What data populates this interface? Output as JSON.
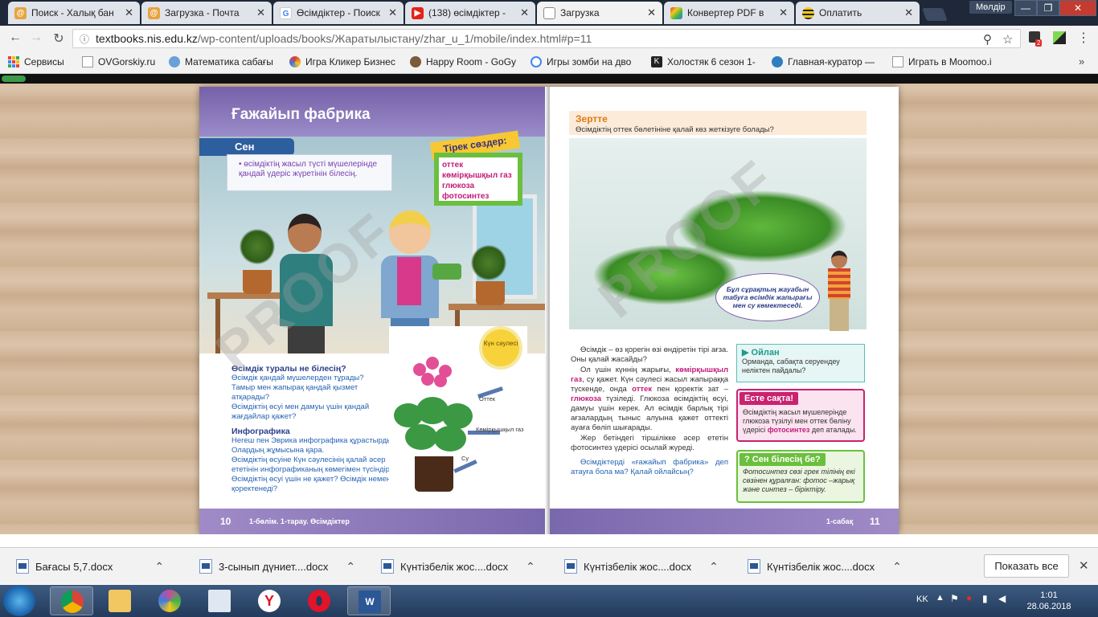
{
  "browser": {
    "tabs": [
      {
        "label": "Поиск - Халық бан",
        "icon": "mail-at-icon",
        "color": "#e8a33d"
      },
      {
        "label": "Загрузка - Почта",
        "icon": "mail-at-icon",
        "color": "#e8a33d"
      },
      {
        "label": "Өсімдіктер - Поиск",
        "icon": "google-icon",
        "color": "#4285f4"
      },
      {
        "label": "(138) өсімдіктер -",
        "icon": "youtube-icon",
        "color": "#e62117"
      },
      {
        "label": "Загрузка",
        "icon": "page-icon",
        "color": "#888888",
        "active": true
      },
      {
        "label": "Конвертер PDF в",
        "icon": "converter-icon",
        "color": "#7a5cc7"
      },
      {
        "label": "Оплатить",
        "icon": "beeline-icon",
        "color": "#f4c61d"
      }
    ],
    "window_user": "Мөлдір",
    "url_host": "textbooks.nis.edu.kz",
    "url_path": "/wp-content/uploads/books/Жаратылыстану/zhar_u_1/mobile/index.html#p=11",
    "extension_badge": "2"
  },
  "bookmarks": [
    {
      "label": "Сервисы",
      "icon": "apps-grid-icon",
      "color": "#4285f4"
    },
    {
      "label": "OVGorskiy.ru",
      "icon": "page-icon",
      "color": "#999999"
    },
    {
      "label": "Математика сабағы",
      "icon": "globe-icon",
      "color": "#6aa0d8"
    },
    {
      "label": "Игра Кликер Бизнес",
      "icon": "game-icon",
      "color": "#e23b3b"
    },
    {
      "label": "Happy Room - GoGy",
      "icon": "game-icon",
      "color": "#7b5b3a"
    },
    {
      "label": "Игры зомби на дво",
      "icon": "google-icon",
      "color": "#4285f4"
    },
    {
      "label": "Холостяк 6 сезон 1-",
      "icon": "k-icon",
      "color": "#222222"
    },
    {
      "label": "Главная-куратор —",
      "icon": "globe-icon",
      "color": "#2d7fc1"
    },
    {
      "label": "Играть в Moomoo.i",
      "icon": "page-icon",
      "color": "#999999"
    }
  ],
  "book": {
    "left": {
      "lesson_title": "Ғажайып фабрика",
      "sen_label": "Сен",
      "sen_text": "өсімдіктің жасыл түсті мүшелерінде қандай үдеріс жүретінін білесің.",
      "terms_title": "Тірек сөздер:",
      "terms": [
        "оттек",
        "көмірқышқыл газ",
        "глюкоза",
        "фотосинтез"
      ],
      "q_heading": "Өсімдік туралы не білесің?",
      "q_lines": [
        "Өсімдік қандай мүшелерден тұрады?",
        "Тамыр мен жапырақ қандай қызмет атқарады?",
        "Өсімдіктің өсуі мен дамуы үшін қандай жағдайлар қажет?"
      ],
      "info_heading": "Инфографика",
      "info_lines": [
        "Негеш пен Эврика инфографика құрастырды. Олардың жұмысына қара.",
        "Өсімдіктің өсуіне Күн сәулесінің қалай әсер ететінін инфографиканың көмегімен түсіндір.",
        "Өсімдіктің өсуі үшін не қажет? Өсімдік немен қоректенеді?"
      ],
      "sun_label": "Күн сәулесі",
      "label_oxygen": "Оттек",
      "label_co2": "Көмірқышқыл газ",
      "label_water": "Су",
      "page_number": "10",
      "footer": "1-бөлім. 1-тарау. Өсімдіктер"
    },
    "right": {
      "zert_title": "Зертте",
      "zert_question": "Өсімдіктің оттек бөлетініне қалай көз жеткізуге болады?",
      "bubble": "Бұл сұрақтың жауабын табуға өсімдік жапырағы мен су көмектеседі.",
      "body_p1": "Өсімдік – өз қорегін өзі өндіретін тірі ағза. Оны қалай жасайды?",
      "body_p2a": "Ол үшін күннің жарығы,",
      "body_kw1": "көмірқышқыл газ",
      "body_p2b": ", су қажет. Күн сәулесі жасыл жапыраққа түскенде, онда",
      "body_kw2": "оттек",
      "body_p2c": "пен қоректік зат –",
      "body_kw3": "глюкоза",
      "body_p2d": "түзіледі. Глюкоза өсімдіктің өсуі, дамуы үшін керек. Ал өсімдік барлық тірі ағзалардың тыныс алуына қажет оттекті ауаға бөліп шығарады.",
      "body_p3": "Жер бетіндегі тіршілікке әсер ететін фотосинтез үдерісі осылай жүреді.",
      "body_q": "Өсімдіктерді «ғажайып фабрика» деп атауға бола ма? Қалай ойлайсың?",
      "oilan_title": "Ойлан",
      "oilan_text": "Орманда, сабақта серуендеу неліктен пайдалы?",
      "este_title": "Есте сақта!",
      "este_text_a": "Өсімдіктің жасыл мүшелерінде глюкоза түзілуі мен оттек бөліну үдерісі",
      "este_kw": "фотосинтез",
      "este_text_b": "деп аталады.",
      "senbil_title": "Сен білесің бе?",
      "senbil_text": "Фотосинтез сөзі грек тілінің екі сөзінен құралған: фотос –жарық және синтез – біріктіру.",
      "page_number": "11",
      "footer": "1-сабақ"
    },
    "watermark": "PROOF"
  },
  "downloads": {
    "items": [
      {
        "label": "Бағасы  5,7.docx"
      },
      {
        "label": "3-сынып дүниет....docx"
      },
      {
        "label": "Күнтізбелік жос....docx"
      },
      {
        "label": "Күнтізбелік жос....docx"
      },
      {
        "label": "Күнтізбелік жос....docx"
      }
    ],
    "show_all": "Показать все"
  },
  "taskbar": {
    "apps": [
      {
        "name": "chrome-icon",
        "color": "#e9b634",
        "active": true
      },
      {
        "name": "explorer-icon",
        "color": "#f2c660"
      },
      {
        "name": "paint-icon",
        "color": "#c74d9a"
      },
      {
        "name": "notepad-icon",
        "color": "#dfe7f3"
      },
      {
        "name": "yandex-icon",
        "color": "#ffffff"
      },
      {
        "name": "opera-icon",
        "color": "#e0142a"
      },
      {
        "name": "word-icon",
        "color": "#2b5797",
        "active": true
      }
    ],
    "lang": "KK",
    "time": "1:01",
    "date": "28.06.2018"
  }
}
